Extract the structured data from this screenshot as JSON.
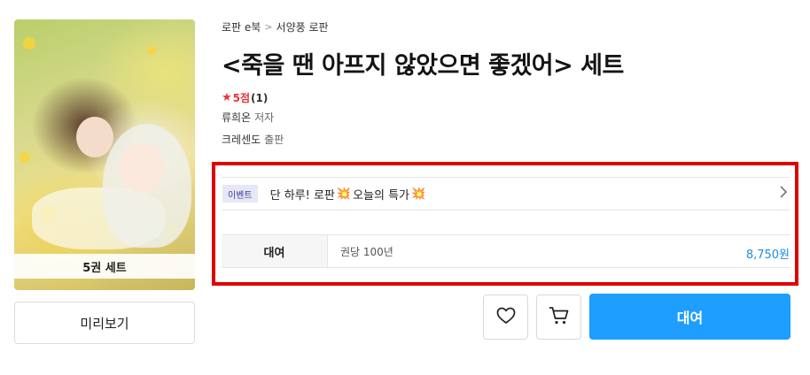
{
  "cover": {
    "badge": "5권 세트"
  },
  "preview_button": "미리보기",
  "breadcrumb": {
    "items": [
      "로판 e북",
      "서양풍 로판"
    ],
    "separator": ">"
  },
  "title": "<죽을 땐 아프지 않았으면 좋겠어> 세트",
  "rating": {
    "score": "5점",
    "count": "(1)",
    "star_color": "#e8333c"
  },
  "author": {
    "name": "류희온",
    "role": "저자"
  },
  "publisher": {
    "name": "크레센도",
    "role": "출판"
  },
  "event": {
    "tag": "이벤트",
    "text_before": "단 하루! 로판",
    "text_mid": "오늘의 특가",
    "emoji_icon": "collision-icon"
  },
  "rent": {
    "label": "대여",
    "description": "권당 100년",
    "price": "8,750원",
    "price_color": "#1f8ce0"
  },
  "actions": {
    "wishlist_icon": "heart-icon",
    "cart_icon": "cart-icon",
    "rent_button": "대여",
    "accent": "#1e9eff"
  },
  "highlight_color": "#e00000"
}
